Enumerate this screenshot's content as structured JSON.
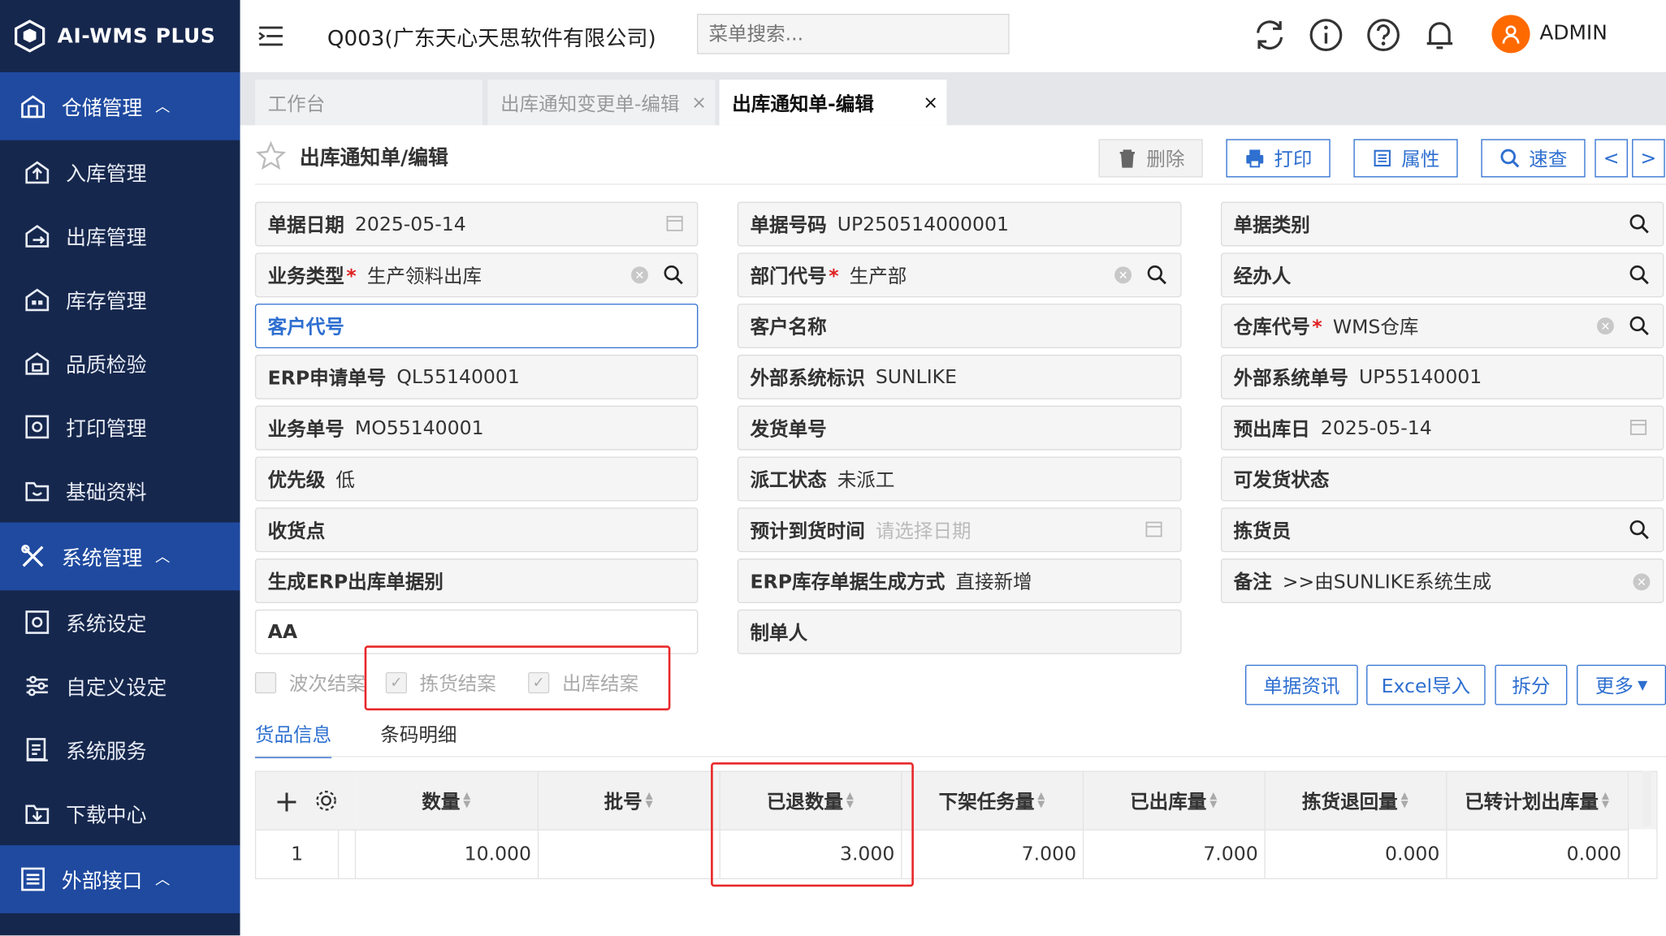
{
  "app": {
    "logo_text": "AI-WMS PLUS"
  },
  "topbar": {
    "company": "Q003(广东天心天思软件有限公司)",
    "search_placeholder": "菜单搜索...",
    "user": "ADMIN"
  },
  "sidebar": {
    "groups": [
      {
        "label": "仓储管理",
        "items": [
          "入库管理",
          "出库管理",
          "库存管理",
          "品质检验",
          "打印管理",
          "基础资料"
        ]
      },
      {
        "label": "系统管理",
        "items": [
          "系统设定",
          "自定义设定",
          "系统服务",
          "下载中心"
        ]
      },
      {
        "label": "外部接口",
        "items": []
      }
    ]
  },
  "tabs": [
    {
      "label": "工作台"
    },
    {
      "label": "出库通知变更单-编辑",
      "close": "×"
    },
    {
      "label": "出库通知单-编辑",
      "close": "×"
    }
  ],
  "page": {
    "title": "出库通知单/编辑",
    "toolbar": {
      "delete": "删除",
      "print": "打印",
      "props": "属性",
      "query": "速查",
      "prev": "<",
      "next": ">"
    }
  },
  "form": {
    "col1": [
      {
        "label": "单据日期",
        "value": "2025-05-14"
      },
      {
        "label": "业务类型",
        "required": "*",
        "value": "生产领料出库"
      },
      {
        "label": "客户代号",
        "value": ""
      },
      {
        "label": "ERP申请单号",
        "value": "QL55140001"
      },
      {
        "label": "业务单号",
        "value": "MO55140001"
      },
      {
        "label": "优先级",
        "value": "低"
      },
      {
        "label": "收货点",
        "value": ""
      },
      {
        "label": "生成ERP出库单据别",
        "value": ""
      },
      {
        "label": "AA",
        "value": ""
      }
    ],
    "col2": [
      {
        "label": "单据号码",
        "value": "UP250514000001"
      },
      {
        "label": "部门代号",
        "required": "*",
        "value": "生产部"
      },
      {
        "label": "客户名称",
        "value": ""
      },
      {
        "label": "外部系统标识",
        "value": "SUNLIKE"
      },
      {
        "label": "发货单号",
        "value": ""
      },
      {
        "label": "派工状态",
        "value": "未派工"
      },
      {
        "label": "预计到货时间",
        "placeholder": "请选择日期"
      },
      {
        "label": "ERP库存单据生成方式",
        "value": "直接新增"
      },
      {
        "label": "制单人",
        "value": ""
      }
    ],
    "col3": [
      {
        "label": "单据类别",
        "value": ""
      },
      {
        "label": "经办人",
        "value": ""
      },
      {
        "label": "仓库代号",
        "required": "*",
        "value": "WMS仓库"
      },
      {
        "label": "外部系统单号",
        "value": "UP55140001"
      },
      {
        "label": "预出库日",
        "value": "2025-05-14"
      },
      {
        "label": "可发货状态",
        "value": ""
      },
      {
        "label": "拣货员",
        "value": ""
      },
      {
        "label": "备注",
        "value": ">>由SUNLIKE系统生成"
      }
    ]
  },
  "checkboxes": [
    {
      "label": "波次结案",
      "checked": false
    },
    {
      "label": "拣货结案",
      "checked": true
    },
    {
      "label": "出库结案",
      "checked": true
    }
  ],
  "actions": {
    "doc_info": "单据资讯",
    "excel_import": "Excel导入",
    "split": "拆分",
    "more": "更多"
  },
  "subtabs": [
    {
      "label": "货品信息",
      "active": true
    },
    {
      "label": "条码明细",
      "active": false
    }
  ],
  "table": {
    "columns": [
      "数量",
      "批号",
      "已退数量",
      "下架任务量",
      "已出库量",
      "拣货退回量",
      "已转计划出库量"
    ],
    "rows": [
      {
        "index": "1",
        "cells": [
          "10.000",
          "",
          "3.000",
          "7.000",
          "7.000",
          "0.000",
          "0.000"
        ]
      }
    ]
  },
  "colors": {
    "sidebar_bg": "#16274d",
    "sidebar_active": "#1f4aa0",
    "accent": "#2e6fd0",
    "highlight": "#e8282a",
    "avatar": "#ff6a00"
  }
}
